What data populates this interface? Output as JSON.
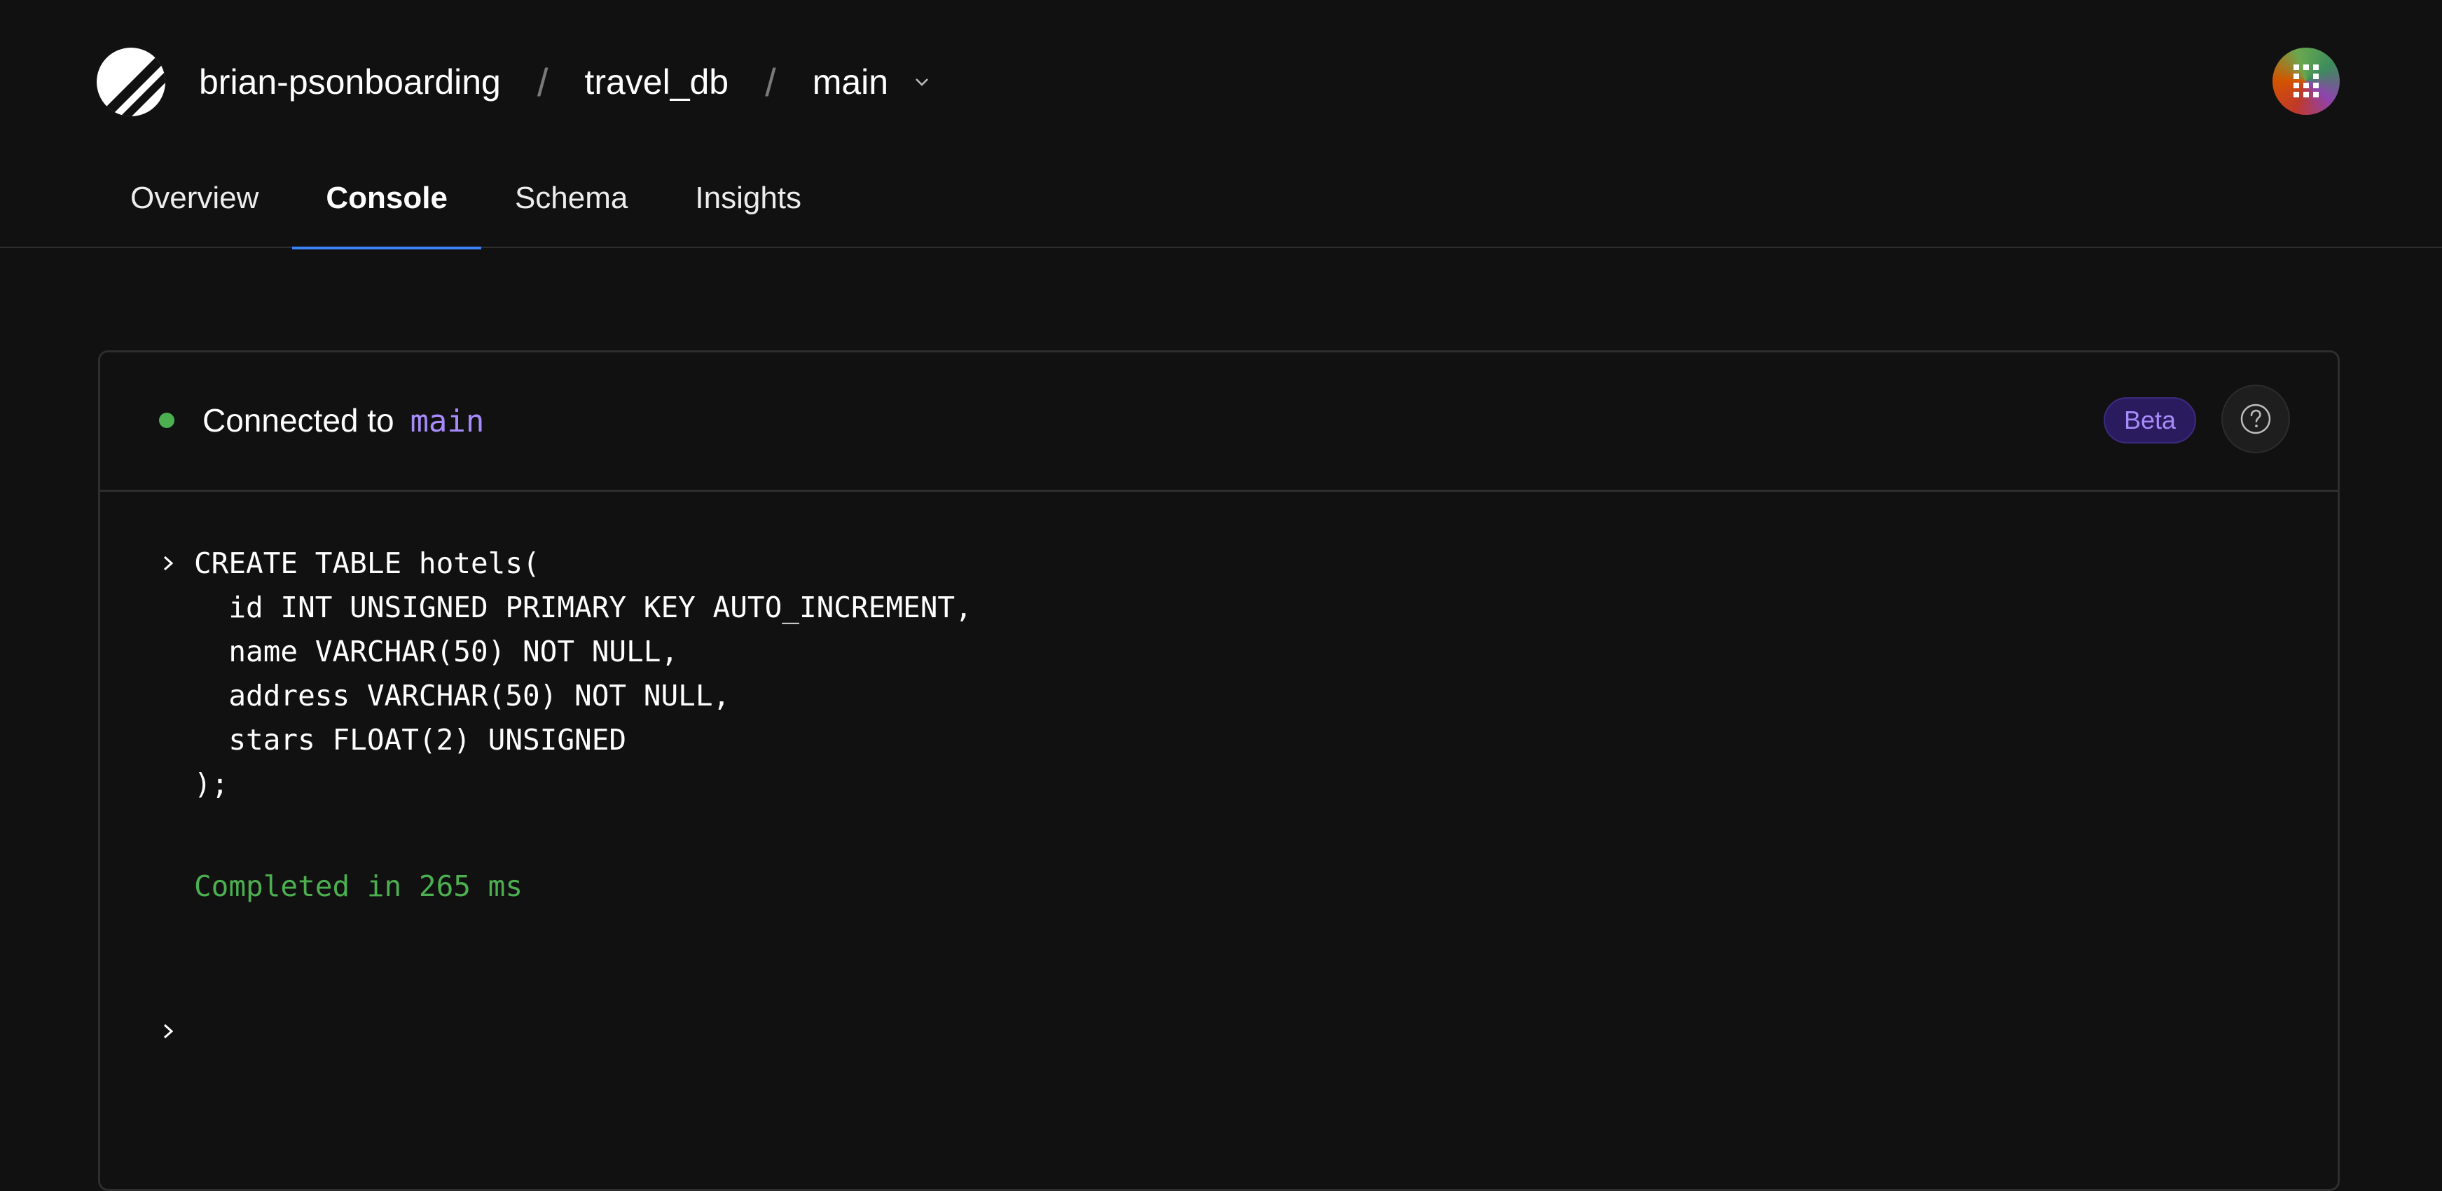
{
  "header": {
    "breadcrumbs": {
      "organization": "brian-psonboarding",
      "database": "travel_db",
      "branch": "main",
      "separator": "/"
    }
  },
  "tabs": [
    {
      "label": "Overview",
      "active": false
    },
    {
      "label": "Console",
      "active": true
    },
    {
      "label": "Schema",
      "active": false
    },
    {
      "label": "Insights",
      "active": false
    }
  ],
  "console": {
    "status_prefix": "Connected to",
    "status_branch": "main",
    "status_color": "#4caf50",
    "badge": "Beta",
    "help_icon": "question-circle-icon",
    "query_lines": [
      "CREATE TABLE hotels(",
      "  id INT UNSIGNED PRIMARY KEY AUTO_INCREMENT,",
      "  name VARCHAR(50) NOT NULL,",
      "  address VARCHAR(50) NOT NULL,",
      "  stars FLOAT(2) UNSIGNED",
      ");"
    ],
    "result": "Completed in 265 ms"
  },
  "colors": {
    "background": "#111111",
    "accent": "#3b82f6",
    "success": "#4caf50",
    "beta_text": "#a78bfa"
  }
}
